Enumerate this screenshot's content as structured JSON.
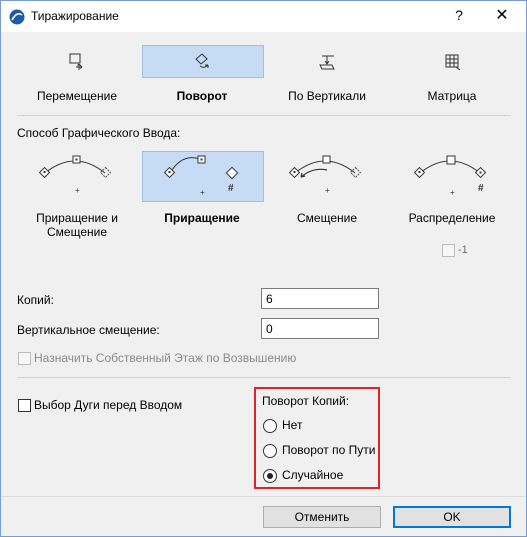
{
  "window": {
    "title": "Тиражирование",
    "help_glyph": "?",
    "close_glyph": "✕"
  },
  "modes": [
    {
      "label": "Перемещение",
      "icon": "move-icon",
      "selected": false
    },
    {
      "label": "Поворот",
      "icon": "rotate-icon",
      "selected": true
    },
    {
      "label": "По Вертикали",
      "icon": "elevate-icon",
      "selected": false
    },
    {
      "label": "Матрица",
      "icon": "matrix-grid-icon",
      "selected": false
    }
  ],
  "input_method": {
    "section_label": "Способ Графического Ввода:",
    "options": [
      {
        "label": "Приращение и Смещение",
        "selected": false
      },
      {
        "label": "Приращение",
        "selected": true
      },
      {
        "label": "Смещение",
        "selected": false
      },
      {
        "label": "Распределение",
        "selected": false
      }
    ],
    "distribution_checkbox_label": "-1",
    "hash_symbol": "#"
  },
  "fields": {
    "copies_label": "Копий:",
    "copies_value": "6",
    "vertical_offset_label": "Вертикальное смещение:",
    "vertical_offset_value": "0"
  },
  "assign_floor_label": "Назначить Собственный Этаж по Возвышению",
  "arc_select_label": "Выбор Дуги перед Вводом",
  "rotate_copies": {
    "group_label": "Поворот Копий:",
    "options": [
      {
        "label": "Нет",
        "selected": false
      },
      {
        "label": "Поворот по Пути",
        "selected": false
      },
      {
        "label": "Случайное",
        "selected": true
      }
    ],
    "highlight_color": "#e0232b"
  },
  "buttons": {
    "cancel": "Отменить",
    "ok": "OK"
  },
  "colors": {
    "selection_bg": "#c5dcf4",
    "accent": "#0078d7"
  }
}
